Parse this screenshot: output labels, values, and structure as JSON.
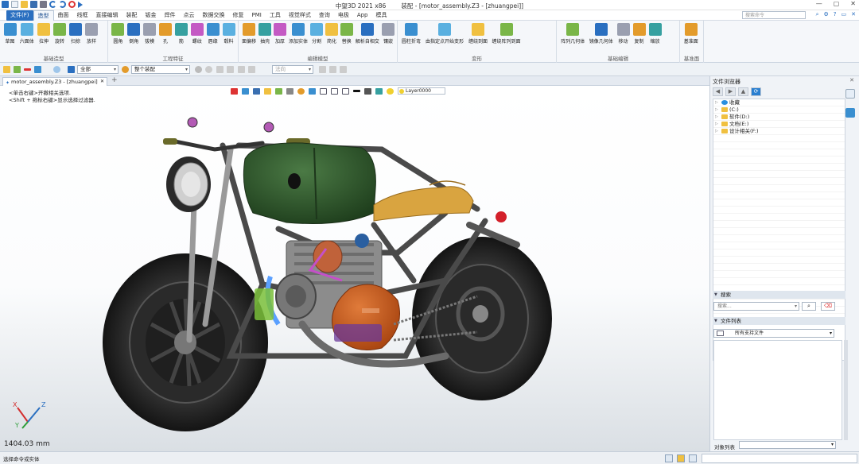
{
  "window": {
    "app_title": "中望3D 2021 x86",
    "doc_title": "装配 - [motor_assembly.Z3 - [zhuangpei]]"
  },
  "menu": {
    "items": [
      "文件(F)",
      "造型",
      "曲面",
      "线框",
      "直接编辑",
      "装配",
      "钣金",
      "焊件",
      "点云",
      "数据交换",
      "修复",
      "PMI",
      "工具",
      "视觉样式",
      "查询",
      "电极",
      "App",
      "模具"
    ],
    "active_index": 1,
    "search_placeholder": "搜索命令"
  },
  "ribbon": {
    "groups": [
      {
        "label": "基础造型",
        "tools": [
          "草图",
          "六面体",
          "拉伸",
          "旋转",
          "扫掠",
          "放样"
        ]
      },
      {
        "label": "工程特征",
        "tools": [
          "圆角",
          "倒角",
          "拔模",
          "孔",
          "筋",
          "螺纹",
          "唇缘",
          "毂料"
        ]
      },
      {
        "label": "编辑模型",
        "tools": [
          "面偏移",
          "抽壳",
          "加厚",
          "添加实体",
          "分割",
          "简化",
          "替换",
          "解析自相交",
          "镶嵌"
        ]
      },
      {
        "label": "变形",
        "tools": [
          "圆柱折弯",
          "由指定点开始变形",
          "缠绕到面",
          "缠绕阵列到面"
        ]
      },
      {
        "label": "基础编辑",
        "tools": [
          "阵列几何体",
          "镜像几何体",
          "移动",
          "复制",
          "缩放"
        ]
      },
      {
        "label": "基准面",
        "tools": [
          "基准面"
        ]
      }
    ]
  },
  "options": {
    "filter_value": "全部",
    "assembly_value": "整个装配",
    "direction_placeholder": "法向"
  },
  "document": {
    "tab_label": "motor_assembly.Z3 - [zhuangpei]"
  },
  "viewport": {
    "hint1": "<单击右键>开撤相关选项.",
    "hint2": "<Shift + 拖标右键>显示选择过滤器.",
    "layer": "Layer0000",
    "measure": "1404.03 mm",
    "axes": {
      "x": "X",
      "y": "Y",
      "z": "Z"
    }
  },
  "file_browser": {
    "title": "文件浏览器",
    "tree": [
      "收藏",
      "(C:)",
      "软件(D:)",
      "文档(E:)",
      "设计相关(F:)"
    ]
  },
  "search_section": {
    "title": "搜索",
    "placeholder": "搜索..."
  },
  "file_list": {
    "title": "文件列表",
    "filter": "所有支持文件"
  },
  "object_list": {
    "label": "对象列表"
  },
  "status": {
    "text": "选择命令或实体"
  },
  "colors": {
    "accent": "#2a6fc0",
    "frame": "#3f403f",
    "tank": "#2d5a2a",
    "seat": "#d9a440",
    "engine": "#c85a1e"
  }
}
